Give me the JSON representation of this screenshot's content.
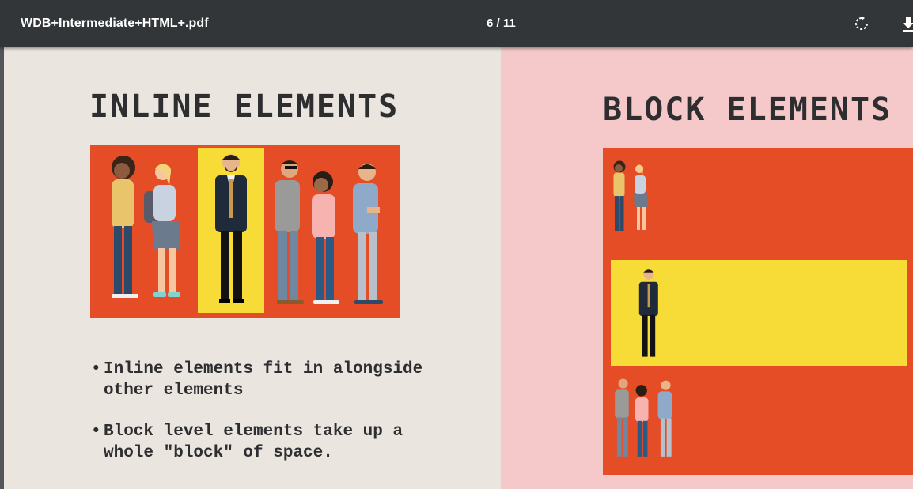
{
  "toolbar": {
    "title": "WDB+Intermediate+HTML+.pdf",
    "page_indicator": "6 / 11",
    "rotate_icon": "rotate-icon",
    "download_icon": "download-icon"
  },
  "slide_left": {
    "heading": "INLINE ELEMENTS",
    "bullets": [
      "Inline elements fit in alongside other elements",
      "Block level elements take up a whole \"block\" of space."
    ]
  },
  "slide_right": {
    "heading": "BLOCK ELEMENTS"
  },
  "colors": {
    "toolbar": "#323639",
    "left_bg": "#ebe5df",
    "right_bg": "#f5c9c9",
    "orange": "#e44d26",
    "yellow": "#f7dc37",
    "text": "#2e2e31"
  }
}
